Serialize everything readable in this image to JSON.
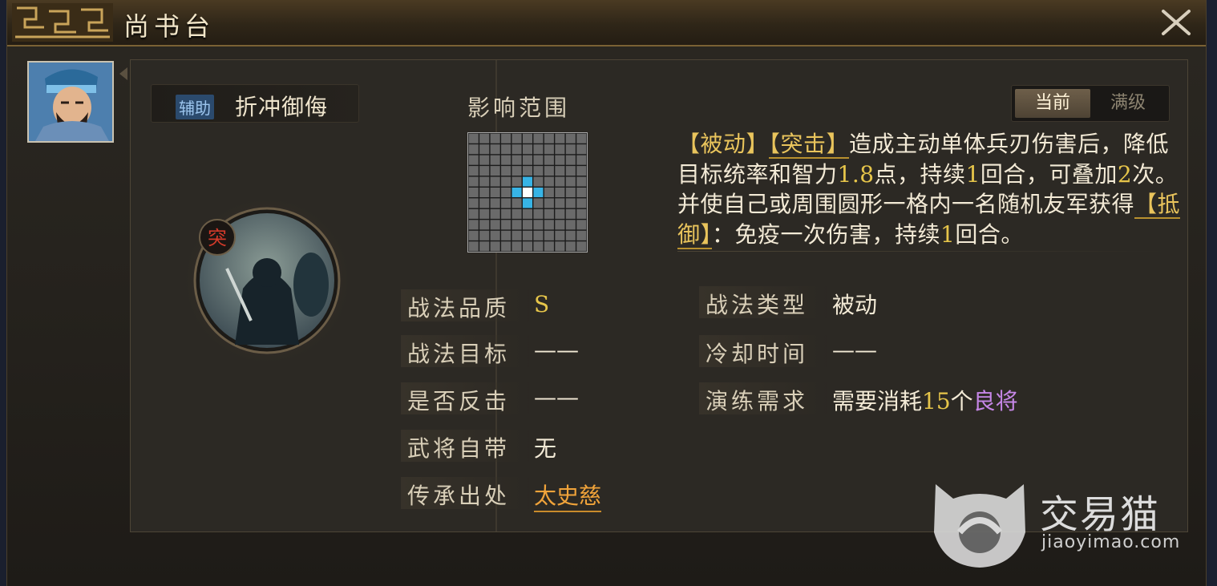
{
  "window": {
    "title": "尚书台"
  },
  "skill": {
    "tag": "辅助",
    "name": "折冲御侮",
    "badge": "突"
  },
  "range": {
    "label": "影响范围",
    "rows": 11,
    "cols": 11,
    "center": [
      5,
      5
    ],
    "affected": [
      [
        4,
        5
      ],
      [
        6,
        5
      ],
      [
        5,
        4
      ],
      [
        5,
        6
      ]
    ],
    "colors": {
      "cell": "#6a6a6a",
      "affected": "#37b4e6",
      "center": "#ffffff"
    }
  },
  "tabs": {
    "current": "当前",
    "max": "满级"
  },
  "description": {
    "parts": [
      {
        "t": "【被动】",
        "c": "kw"
      },
      {
        "t": "【突击】",
        "c": "kw-ul"
      },
      {
        "t": "造成主动单体兵刃伤害后，降低目标统率和智力",
        "c": ""
      },
      {
        "t": "1.8",
        "c": "num"
      },
      {
        "t": "点，持续",
        "c": ""
      },
      {
        "t": "1",
        "c": "num"
      },
      {
        "t": "回合，可叠加",
        "c": ""
      },
      {
        "t": "2",
        "c": "num"
      },
      {
        "t": "次。并使自己或周围圆形一格内一名随机友军获得",
        "c": ""
      },
      {
        "t": "【抵御】",
        "c": "kw-ul"
      },
      {
        "t": "：免疫一次伤害，持续",
        "c": ""
      },
      {
        "t": "1",
        "c": "num"
      },
      {
        "t": "回合。",
        "c": ""
      }
    ]
  },
  "attrs": {
    "quality": {
      "label": "战法品质",
      "value": "S"
    },
    "target": {
      "label": "战法目标",
      "value": "——"
    },
    "counter": {
      "label": "是否反击",
      "value": "——"
    },
    "innate": {
      "label": "武将自带",
      "value": "无"
    },
    "origin": {
      "label": "传承出处",
      "value": "太史慈"
    },
    "type": {
      "label": "战法类型",
      "value": "被动"
    },
    "cooldown": {
      "label": "冷却时间",
      "value": "——"
    },
    "drill": {
      "label": "演练需求",
      "prefix": "需要消耗",
      "count": "15",
      "unit": "个",
      "item": "良将"
    }
  },
  "watermark": {
    "brand": "交易猫",
    "url": "jiaoyimao.com"
  }
}
